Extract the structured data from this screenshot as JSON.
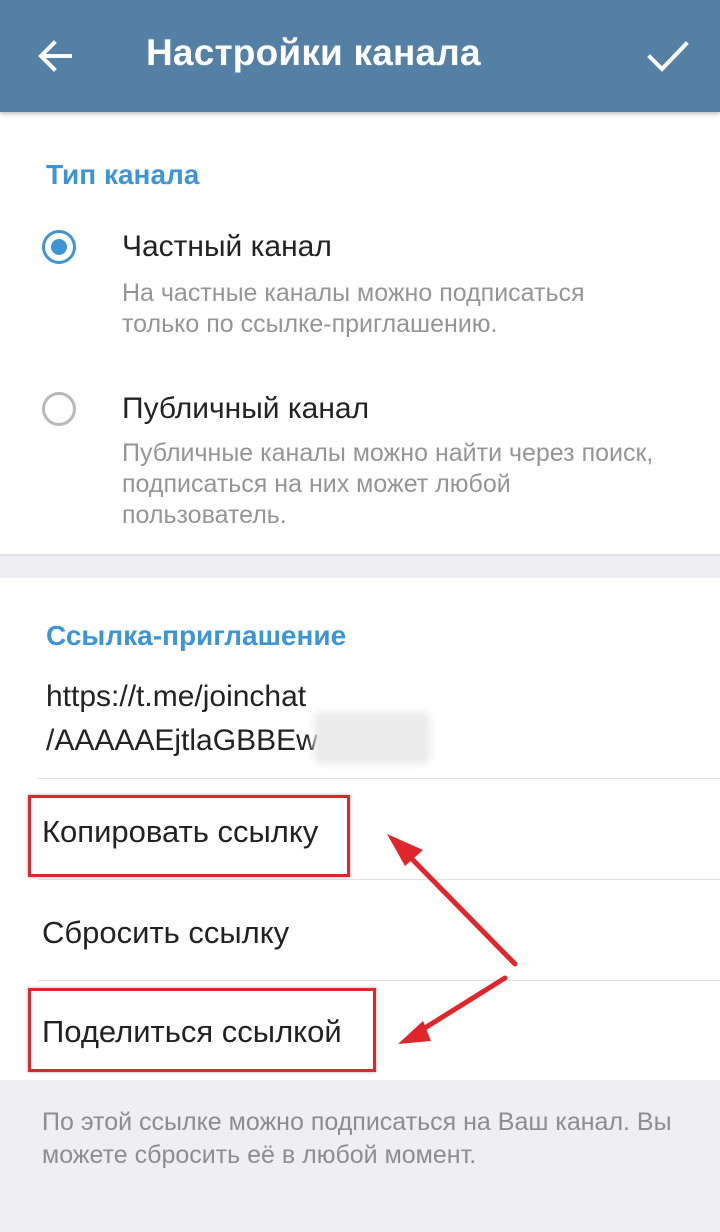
{
  "appbar": {
    "title": "Настройки канала",
    "back_icon": "arrow-left-icon",
    "confirm_icon": "check-icon",
    "background": "#5580a6"
  },
  "channel_type": {
    "header": "Тип канала",
    "options": [
      {
        "title": "Частный канал",
        "description": "На частные каналы можно подписаться только по ссылке-приглашению.",
        "selected": true
      },
      {
        "title": "Публичный канал",
        "description": "Публичные каналы можно найти через поиск, подписаться на них может любой пользователь.",
        "selected": false
      }
    ]
  },
  "invite": {
    "header": "Ссылка-приглашение",
    "link_line1": "https://t.me/joinchat",
    "link_line2": "/AAAAAEjtlaGBBEw",
    "actions": {
      "copy": "Копировать ссылку",
      "reset": "Сбросить ссылку",
      "share": "Поделиться ссылкой"
    },
    "footnote": "По этой ссылке можно подписаться на Ваш канал. Вы можете сбросить её в любой момент."
  },
  "colors": {
    "accent": "#3d95d4",
    "annotation": "#e0262a"
  }
}
